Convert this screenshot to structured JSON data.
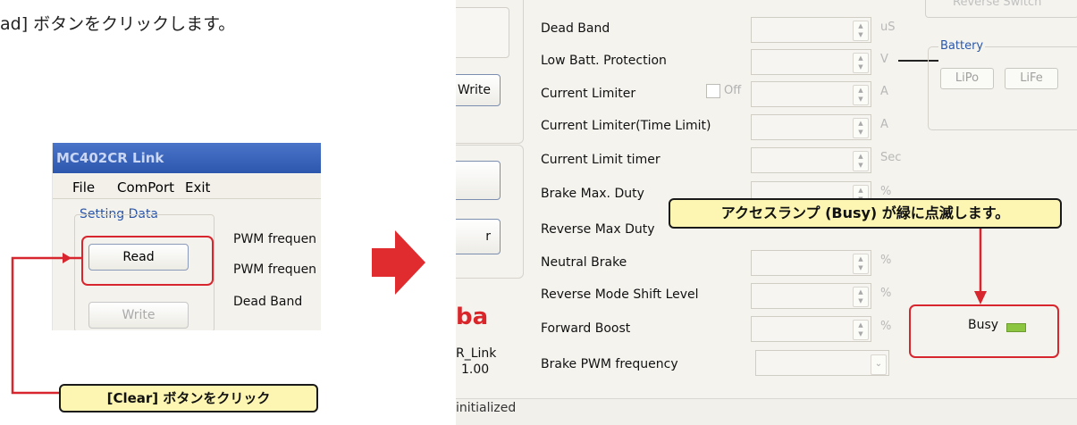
{
  "instruction": "ad] ボタンをクリックします。",
  "left_window": {
    "title": "MC402CR Link",
    "menu": [
      "File",
      "ComPort",
      "Exit"
    ],
    "group_label": "Setting Data",
    "read_label": "Read",
    "write_label": "Write",
    "fields": [
      "PWM frequen",
      "PWM frequen",
      "Dead Band"
    ]
  },
  "callout_clear": "[Clear] ボタンをクリック",
  "right_window": {
    "rows": [
      {
        "label": "Dead Band",
        "unit": "uS"
      },
      {
        "label": "Low Batt. Protection",
        "unit": "V"
      },
      {
        "label": "Current Limiter",
        "unit": "A"
      },
      {
        "label": "Current Limiter(Time Limit)",
        "unit": "A"
      },
      {
        "label": "Current Limit timer",
        "unit": "Sec"
      },
      {
        "label": "Brake Max. Duty",
        "unit": "%"
      },
      {
        "label": "Reverse Max Duty",
        "unit": ""
      },
      {
        "label": "Neutral Brake",
        "unit": "%"
      },
      {
        "label": "Reverse Mode Shift Level",
        "unit": "%"
      },
      {
        "label": "Forward Boost",
        "unit": "%"
      },
      {
        "label": "Brake PWM frequency",
        "unit": ""
      }
    ],
    "current_limiter_off": "Off",
    "left_buttons": [
      "Write",
      "",
      "r"
    ],
    "logo_text": "ba",
    "app_name": "R_Link",
    "version": "1.00",
    "status": "initialized",
    "reverse_switch": "Reverse Switch",
    "battery_label": "Battery",
    "battery_options": [
      "LiPo",
      "LiFe"
    ],
    "busy_label": "Busy",
    "busy_lamp_color": "#8cc540"
  },
  "callout_busy": "アクセスランプ (Busy) が緑に点滅します。",
  "colors": {
    "highlight": "#d7262e",
    "callout_bg": "#fdf6b2",
    "title_bar": "#3a63b8"
  }
}
